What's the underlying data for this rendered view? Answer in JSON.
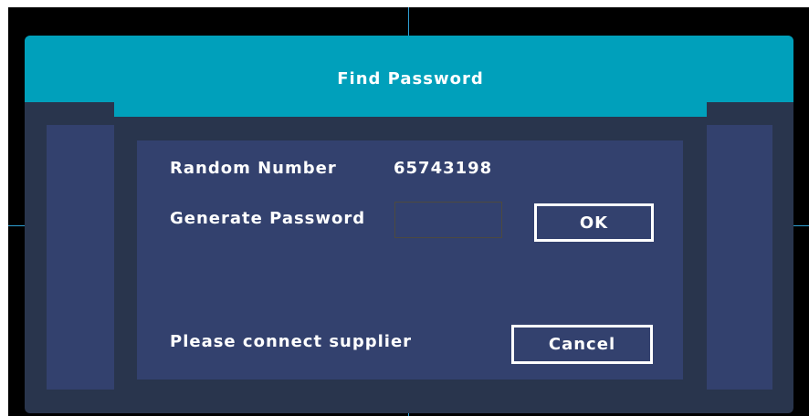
{
  "dialog": {
    "title": "Find Password",
    "random_number_label": "Random Number",
    "random_number_value": "65743198",
    "generate_password_label": "Generate Password",
    "generate_password_value": "",
    "ok_label": "OK",
    "message": "Please connect supplier",
    "cancel_label": "Cancel"
  },
  "colors": {
    "title_bar": "#00a0bb",
    "dialog_frame": "#29354d",
    "panel": "#33416e",
    "text": "#ffffff",
    "crosshair": "#2f9fd3"
  }
}
